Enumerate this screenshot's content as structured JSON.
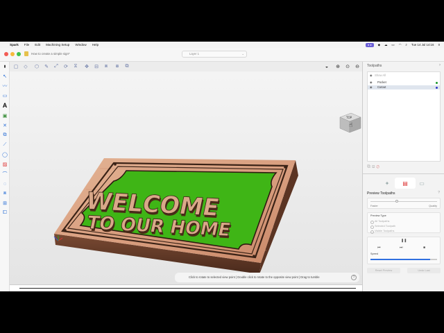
{
  "menubar": {
    "apple": "",
    "app": "Spark",
    "items": [
      "File",
      "Edit",
      "Machining Setup",
      "Window",
      "Help"
    ],
    "datetime": "Tue 14 Jul  14:16"
  },
  "window": {
    "doc_name": "How to create a simple sign*",
    "layer": "Layer 1"
  },
  "viewport": {
    "sign_line1": "WELCOME",
    "sign_line2": "TO OUR HOME",
    "nav_cube": "TOP",
    "hint": "Click to rotate to selected view point  |  Double click to rotate to the opposite view point  |  Drag to tumble",
    "help": "?"
  },
  "panel": {
    "title": "Toolpaths",
    "show_all": "Show All",
    "toolpaths": [
      {
        "name": "Pocket",
        "color": "#1c9a2a"
      },
      {
        "name": "Cutout",
        "color": "#2d36c9"
      }
    ],
    "preview_title": "Preview Toolpaths",
    "faster": "Faster",
    "quality": "Quality",
    "preview_type": "Preview Type",
    "options": [
      "All Toolpaths",
      "Selected Toolpath",
      "Visible Toolpaths"
    ],
    "speed": "Speed",
    "reset_button": "Reset Preview",
    "undo_button": "Undo Last"
  }
}
